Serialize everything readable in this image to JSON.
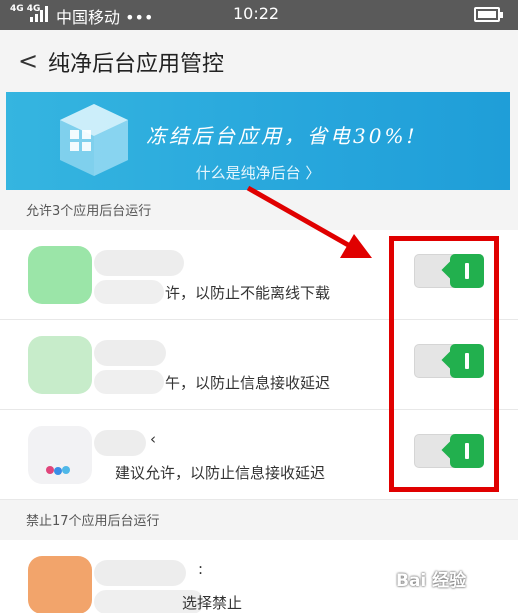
{
  "status_bar": {
    "network": "4G 4G",
    "carrier": "中国移动 •••",
    "time": "10:22"
  },
  "nav": {
    "back_icon": "chevron-left-icon",
    "back_glyph": "<",
    "title": "纯净后台应用管控"
  },
  "banner": {
    "slogan": "冻结后台应用，省电30%!",
    "link": "什么是纯净后台 〉"
  },
  "allowed_section": {
    "header": "允许3个应用后台运行",
    "items": [
      {
        "name": "",
        "desc": "许，以防止不能离线下载",
        "enabled": true
      },
      {
        "name": "",
        "desc": "午，以防止信息接收延迟",
        "enabled": true
      },
      {
        "name": "‹",
        "desc": "建议允许，以防止信息接收延迟",
        "enabled": true
      }
    ]
  },
  "blocked_section": {
    "header": "禁止17个应用后台运行",
    "items": [
      {
        "name": ":",
        "desc": "选择禁止"
      }
    ]
  },
  "watermark": {
    "text": "Bai 经验"
  },
  "colors": {
    "accent_green": "#22b04e",
    "banner_blue": "#27a6dc",
    "annotation_red": "#e00000",
    "status_bar": "#5a5a5a"
  }
}
